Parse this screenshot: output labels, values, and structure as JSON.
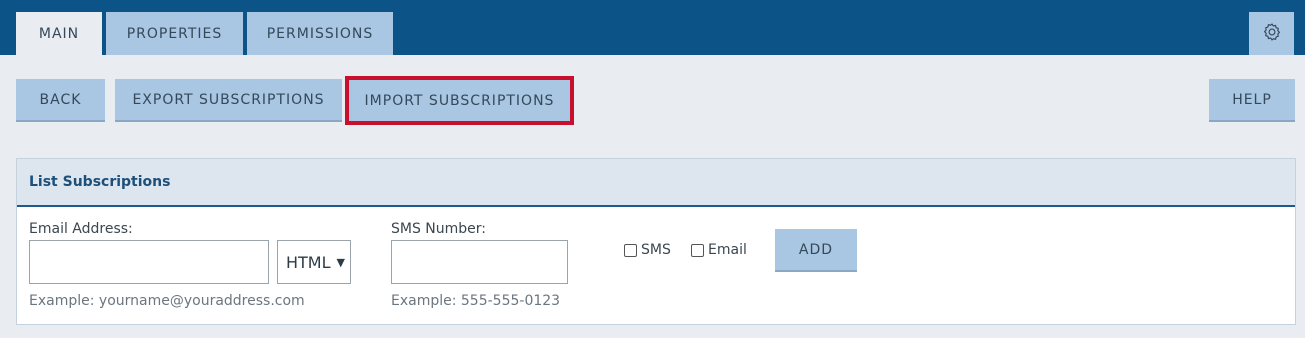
{
  "tabs": {
    "main": "MAIN",
    "properties": "PROPERTIES",
    "permissions": "PERMISSIONS"
  },
  "settings_icon": "gear-icon",
  "toolbar": {
    "back": "BACK",
    "export": "EXPORT SUBSCRIPTIONS",
    "import": "IMPORT SUBSCRIPTIONS",
    "help": "HELP"
  },
  "panel": {
    "title": "List Subscriptions",
    "email_label": "Email Address:",
    "email_value": "",
    "email_example": "Example: yourname@youraddress.com",
    "format_selected": "HTML",
    "sms_label": "SMS Number:",
    "sms_value": "",
    "sms_example": "Example: 555-555-0123",
    "checkbox_sms": "SMS",
    "checkbox_email": "Email",
    "add_button": "ADD"
  },
  "colors": {
    "topbar": "#0c5387",
    "tab_inactive": "#a9c6e2",
    "highlight": "#c8102e"
  }
}
